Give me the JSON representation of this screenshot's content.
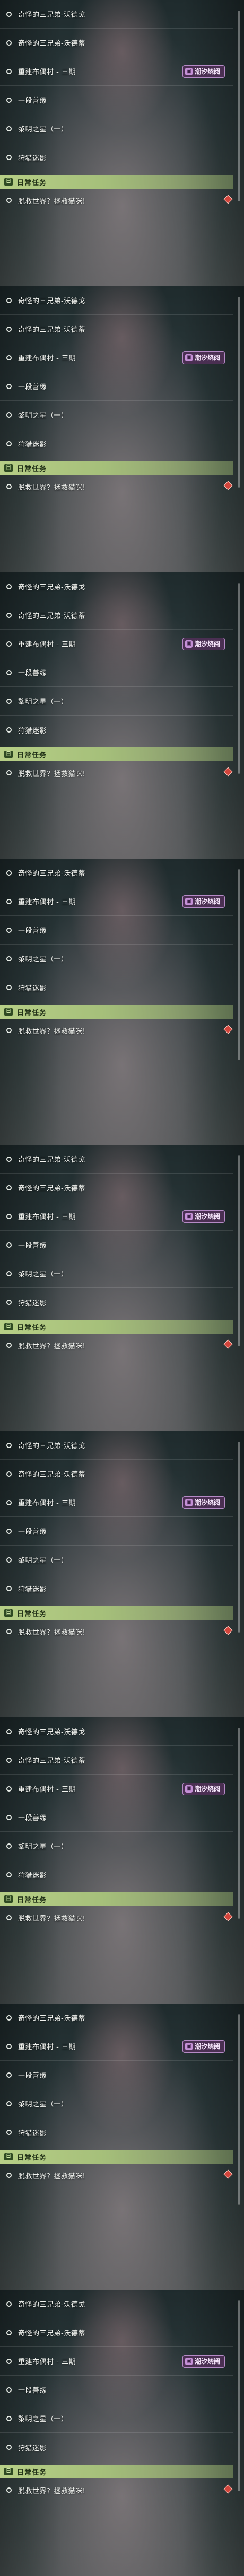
{
  "quests": [
    "奇怪的三兄弟-沃德戈",
    "奇怪的三兄弟-沃德蒂",
    "重建布偶村 - 三期",
    "一段善缘",
    "黎明之星（一）",
    "狩猎迷影"
  ],
  "event_badge": {
    "icon": "calendar-icon",
    "label": "潮汐烧阅"
  },
  "daily_header": {
    "icon": "quest-book-icon",
    "label": "日常任务"
  },
  "daily_quest": "脱救世界？拯救猫咪!",
  "tracker_diamond_color": "#d2443b",
  "pages": [
    {
      "first_visible": 0,
      "offset": 0
    },
    {
      "first_visible": 0,
      "offset": 0
    },
    {
      "first_visible": 0,
      "offset": 0
    },
    {
      "first_visible": 1,
      "offset": 0
    },
    {
      "first_visible": 0,
      "offset": 0
    },
    {
      "first_visible": 0,
      "offset": 0
    },
    {
      "first_visible": 0,
      "offset": 0
    },
    {
      "first_visible": 1,
      "offset": 0
    },
    {
      "first_visible": 0,
      "offset": 0
    }
  ]
}
